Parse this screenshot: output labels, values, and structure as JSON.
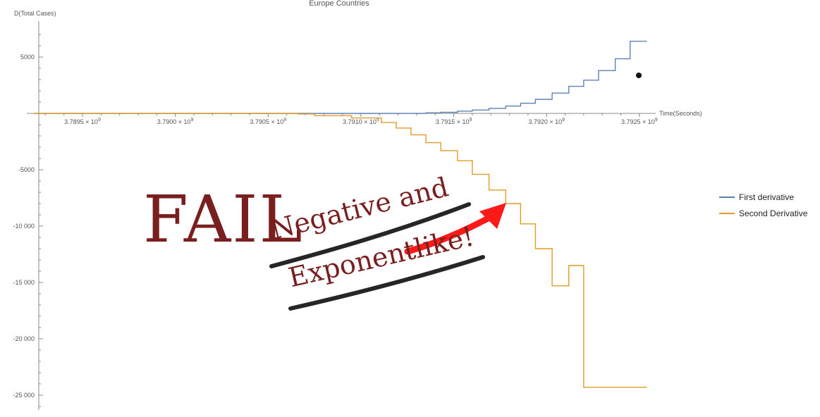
{
  "chart_data": {
    "type": "line",
    "title": "Europe Countries",
    "xlabel": "Time(Seconds)",
    "ylabel": "D(Total Cases)",
    "xlim": [
      3789200000,
      3792550000
    ],
    "ylim": [
      -26000,
      8000
    ],
    "x_ticks": [
      {
        "value": 3789500000,
        "label": "3.7895",
        "exp": "9"
      },
      {
        "value": 3790000000,
        "label": "3.7900",
        "exp": "9"
      },
      {
        "value": 3790500000,
        "label": "3.7905",
        "exp": "9"
      },
      {
        "value": 3791000000,
        "label": "3.7910",
        "exp": "9"
      },
      {
        "value": 3791500000,
        "label": "3.7915",
        "exp": "9"
      },
      {
        "value": 3792000000,
        "label": "3.7920",
        "exp": "9"
      },
      {
        "value": 3792500000,
        "label": "3.7925",
        "exp": "9"
      }
    ],
    "x_tick_multiplier": "× 10",
    "y_ticks": [
      {
        "value": 5000,
        "label": "5000"
      },
      {
        "value": -5000,
        "label": "-5000"
      },
      {
        "value": -10000,
        "label": "-10 000"
      },
      {
        "value": -15000,
        "label": "-15 000"
      },
      {
        "value": -20000,
        "label": "-20 000"
      },
      {
        "value": -25000,
        "label": "-25 000"
      }
    ],
    "grid": false,
    "legend_position": "right",
    "series": [
      {
        "name": "First derivative",
        "color": "#5e81b5",
        "step": true,
        "x": [
          3789240000,
          3790660000,
          3791000000,
          3791350000,
          3791430000,
          3791520000,
          3791600000,
          3791690000,
          3791780000,
          3791860000,
          3791940000,
          3792030000,
          3792120000,
          3792200000,
          3792280000,
          3792370000,
          3792450000,
          3792540000
        ],
        "y": [
          0,
          0,
          0,
          50,
          100,
          200,
          300,
          450,
          650,
          900,
          1250,
          1800,
          2400,
          2950,
          3800,
          4850,
          6400,
          6400
        ]
      },
      {
        "name": "Second Derivative",
        "color": "#e19c24",
        "step": true,
        "x": [
          3789240000,
          3790660000,
          3790750000,
          3790950000,
          3791110000,
          3791190000,
          3791270000,
          3791350000,
          3791430000,
          3791520000,
          3791600000,
          3791690000,
          3791780000,
          3791860000,
          3791940000,
          3792030000,
          3792120000,
          3792200000,
          3792280000,
          3792370000,
          3792450000,
          3792540000
        ],
        "y": [
          0,
          -50,
          -200,
          -400,
          -800,
          -1300,
          -1900,
          -2600,
          -3300,
          -4200,
          -5400,
          -6800,
          -8000,
          -9800,
          -12000,
          -15300,
          -13500,
          -24300,
          -24300,
          -24300,
          -24300,
          -24300
        ]
      }
    ]
  },
  "annotations": {
    "fail_text": "FAIL",
    "note_line1": "Negative and",
    "note_line2": "Exponentlike!"
  }
}
